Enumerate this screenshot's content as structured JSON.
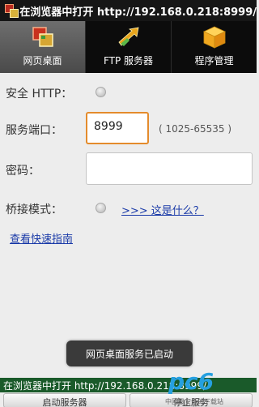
{
  "titlebar": {
    "title": "在浏览器中打开 http://192.168.0.218:8999/"
  },
  "tabs": [
    {
      "label": "网页桌面",
      "icon": "web-desktop-icon",
      "active": true
    },
    {
      "label": "FTP 服务器",
      "icon": "ftp-arrows-icon",
      "active": false
    },
    {
      "label": "程序管理",
      "icon": "box-icon",
      "active": false
    }
  ],
  "form": {
    "secure_http_label": "安全 HTTP：",
    "port_label": "服务端口：",
    "port_value": "8999",
    "port_range": "( 1025-65535 )",
    "password_label": "密码：",
    "password_value": "",
    "bridge_label": "桥接模式：",
    "bridge_link": ">>> 这是什么？",
    "guide_link": "查看快速指南"
  },
  "toast": {
    "text": "网页桌面服务已启动"
  },
  "notification": {
    "text": "在浏览器中打开 http://192.168.0.218:8999/"
  },
  "bottom": {
    "start_button": "启动服务器",
    "stop_button": "停止服务"
  },
  "watermark": {
    "logo": "pc6",
    "sub": "中国最安全的下载站"
  },
  "colors": {
    "accent": "#e48b2c",
    "link": "#1a3aa8",
    "notify": "#1a5a2a",
    "titlebar": "#161616"
  }
}
